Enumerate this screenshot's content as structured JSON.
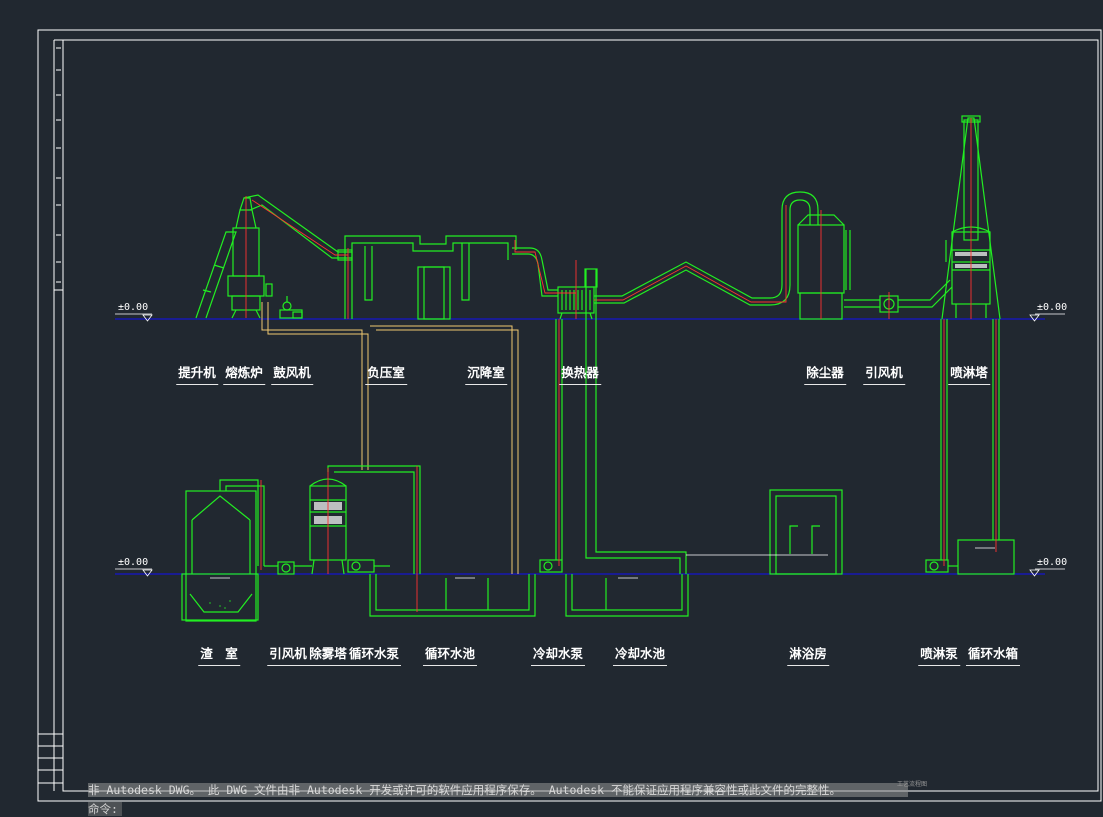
{
  "drawing": {
    "level_marks": [
      "±0.00",
      "±0.00",
      "±0.00",
      "±0.00"
    ],
    "upper_labels": [
      "提升机",
      "熔炼炉",
      "鼓风机",
      "负压室",
      "沉降室",
      "换热器",
      "除尘器",
      "引风机",
      "喷淋塔"
    ],
    "lower_labels": [
      "渣　室",
      "引风机",
      "除雾塔",
      "循环水泵",
      "循环水池",
      "冷却水泵",
      "冷却水池",
      "淋浴房",
      "喷淋泵",
      "循环水箱"
    ],
    "title_block_name": "工艺流程图",
    "colors": {
      "background": "#212830",
      "equipment": "#22ee22",
      "pipe_centerline": "#ff3030",
      "ground_line": "#1515cc",
      "frame": "#ffffff",
      "pipe": "#f0c870"
    }
  },
  "command_line": {
    "history": "非 Autodesk DWG。 此 DWG 文件由非 Autodesk 开发或许可的软件应用程序保存。 Autodesk 不能保证应用程序兼容性或此文件的完整性。",
    "prompt": "命令:"
  }
}
